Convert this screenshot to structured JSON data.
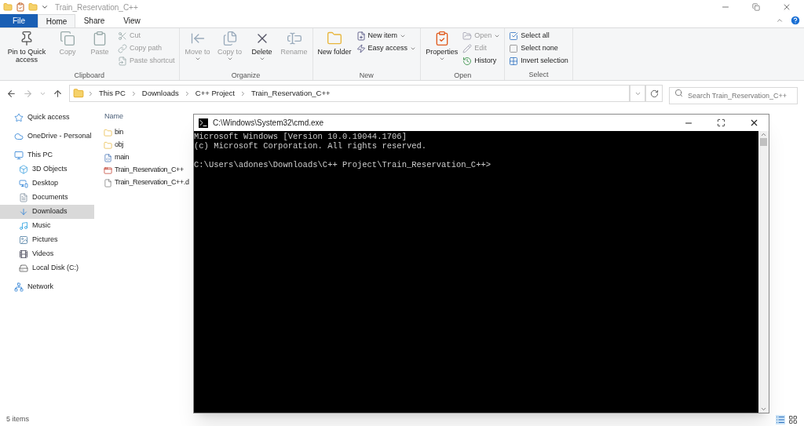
{
  "window": {
    "title": "Train_Reservation_C++"
  },
  "tabs": [
    {
      "label": "File",
      "kind": "file",
      "selected": false
    },
    {
      "label": "Home",
      "kind": "tab",
      "selected": true
    },
    {
      "label": "Share",
      "kind": "tab",
      "selected": false
    },
    {
      "label": "View",
      "kind": "tab",
      "selected": false
    }
  ],
  "ribbon": [
    {
      "label": "Clipboard",
      "buttons": [
        {
          "kind": "large",
          "label": "Pin to Quick access",
          "disabled": false,
          "menu": false
        },
        {
          "kind": "large",
          "label": "Copy",
          "disabled": true,
          "menu": false
        },
        {
          "kind": "large",
          "label": "Paste",
          "disabled": true,
          "menu": false
        },
        {
          "kind": "stack",
          "items": [
            {
              "label": "Cut",
              "disabled": true,
              "menu": false
            },
            {
              "label": "Copy path",
              "disabled": true,
              "menu": false
            },
            {
              "label": "Paste shortcut",
              "disabled": true,
              "menu": false
            }
          ]
        }
      ]
    },
    {
      "label": "Organize",
      "buttons": [
        {
          "kind": "large",
          "label": "Move to",
          "disabled": true,
          "menu": true
        },
        {
          "kind": "large",
          "label": "Copy to",
          "disabled": true,
          "menu": true
        },
        {
          "kind": "large",
          "label": "Delete",
          "disabled": false,
          "menu": true
        },
        {
          "kind": "large",
          "label": "Rename",
          "disabled": true,
          "menu": false
        }
      ]
    },
    {
      "label": "New",
      "buttons": [
        {
          "kind": "large",
          "label": "New folder",
          "disabled": false,
          "menu": false
        },
        {
          "kind": "stack",
          "items": [
            {
              "label": "New item",
              "disabled": false,
              "menu": true
            },
            {
              "label": "Easy access",
              "disabled": false,
              "menu": true
            }
          ]
        }
      ]
    },
    {
      "label": "Open",
      "buttons": [
        {
          "kind": "large",
          "label": "Properties",
          "disabled": false,
          "menu": true
        },
        {
          "kind": "stack",
          "items": [
            {
              "label": "Open",
              "disabled": true,
              "menu": true
            },
            {
              "label": "Edit",
              "disabled": true,
              "menu": false
            },
            {
              "label": "History",
              "disabled": false,
              "menu": false
            }
          ]
        }
      ]
    },
    {
      "label": "Select",
      "buttons": [
        {
          "kind": "stack",
          "items": [
            {
              "label": "Select all",
              "disabled": false,
              "menu": false
            },
            {
              "label": "Select none",
              "disabled": false,
              "menu": false
            },
            {
              "label": "Invert selection",
              "disabled": false,
              "menu": false
            }
          ]
        }
      ]
    }
  ],
  "address": {
    "crumbs": [
      "This PC",
      "Downloads",
      "C++ Project",
      "Train_Reservation_C++"
    ]
  },
  "search": {
    "placeholder": "Search Train_Reservation_C++"
  },
  "nav": [
    {
      "label": "Quick access",
      "selected": false
    },
    {
      "label": "OneDrive - Personal",
      "selected": false
    },
    {
      "label": "This PC",
      "selected": false,
      "children": [
        {
          "label": "3D Objects",
          "selected": false
        },
        {
          "label": "Desktop",
          "selected": false
        },
        {
          "label": "Documents",
          "selected": false
        },
        {
          "label": "Downloads",
          "selected": true
        },
        {
          "label": "Music",
          "selected": false
        },
        {
          "label": "Pictures",
          "selected": false
        },
        {
          "label": "Videos",
          "selected": false
        },
        {
          "label": "Local Disk (C:)",
          "selected": false
        }
      ]
    },
    {
      "label": "Network",
      "selected": false
    }
  ],
  "columns": [
    "Name"
  ],
  "files": [
    {
      "name": "bin",
      "kind": "folder"
    },
    {
      "name": "obj",
      "kind": "folder"
    },
    {
      "name": "main",
      "kind": "source"
    },
    {
      "name": "Train_Reservation_C++",
      "kind": "app"
    },
    {
      "name": "Train_Reservation_C++.d",
      "kind": "file"
    }
  ],
  "status_bar": {
    "count": "5 items"
  },
  "console": {
    "title": "C:\\Windows\\System32\\cmd.exe",
    "blocks": [
      [
        "Microsoft Windows [Version 10.0.19044.1706]",
        "(c) Microsoft Corporation. All rights reserved."
      ],
      [
        "C:\\Users\\adones\\Downloads\\C++ Project\\Train_Reservation_C++>"
      ]
    ]
  }
}
